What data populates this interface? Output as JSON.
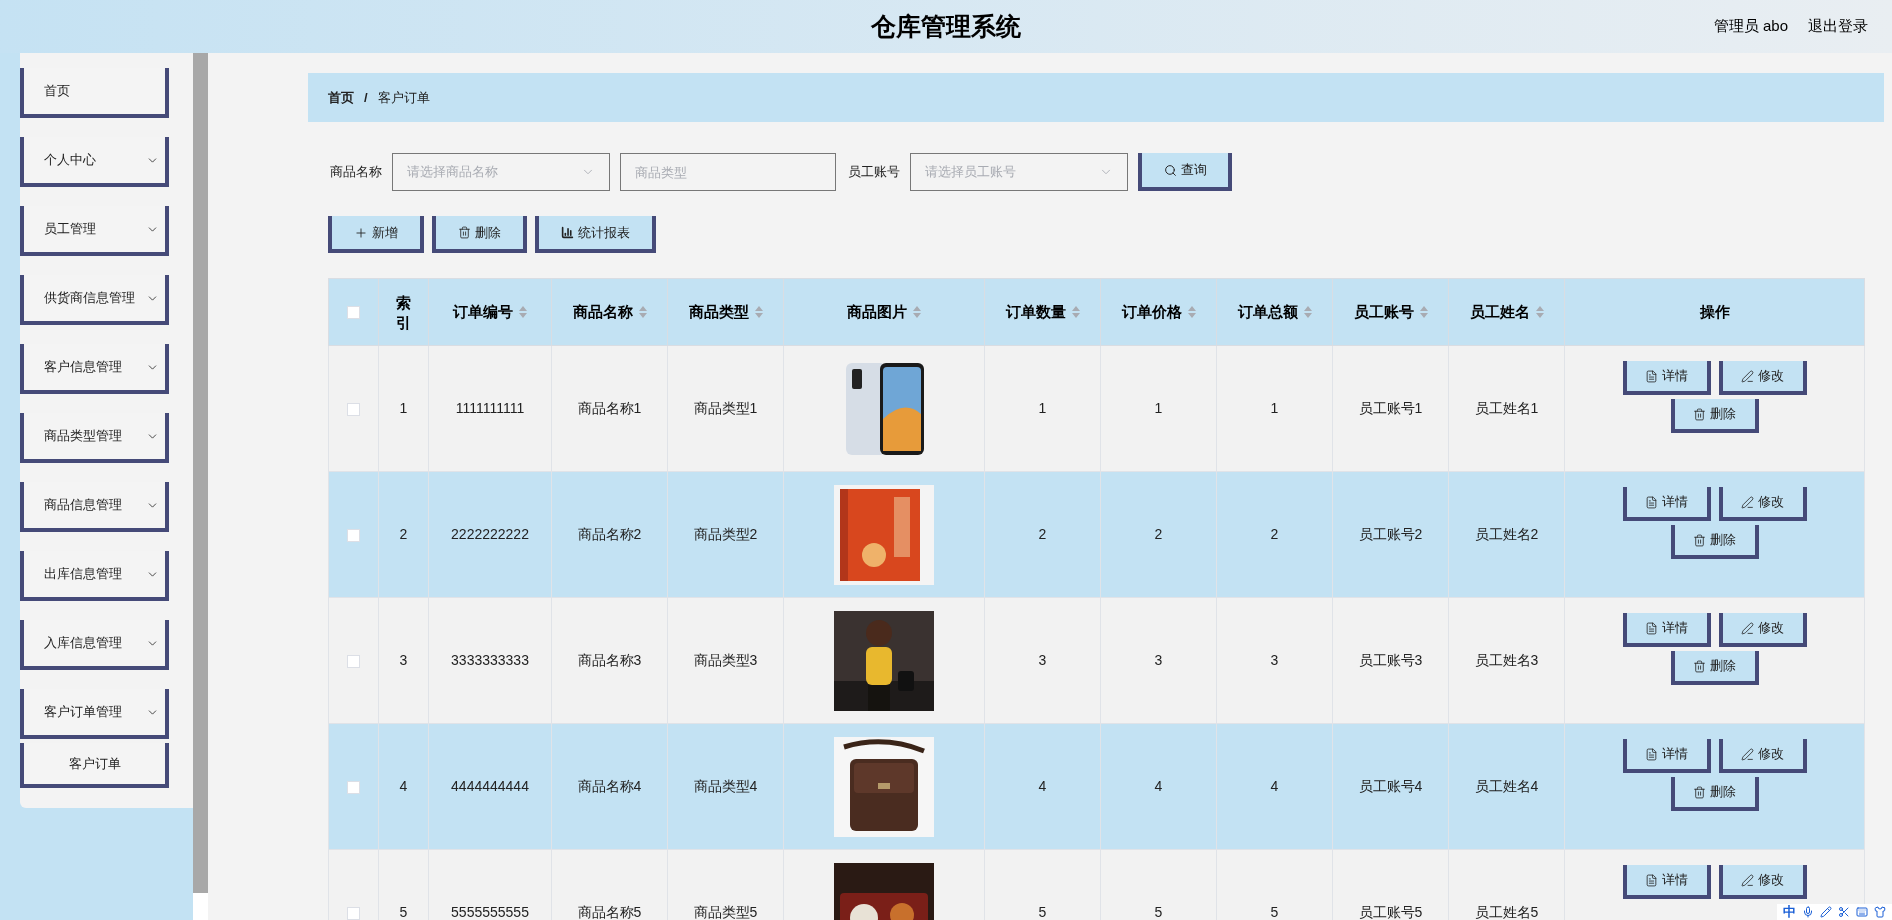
{
  "header": {
    "title": "仓库管理系统",
    "user": "管理员 abo",
    "logout": "退出登录"
  },
  "sidebar": {
    "items": [
      {
        "label": "首页",
        "kind": "link"
      },
      {
        "label": "个人中心",
        "kind": "menu"
      },
      {
        "label": "员工管理",
        "kind": "menu"
      },
      {
        "label": "供货商信息管理",
        "kind": "menu"
      },
      {
        "label": "客户信息管理",
        "kind": "menu"
      },
      {
        "label": "商品类型管理",
        "kind": "menu"
      },
      {
        "label": "商品信息管理",
        "kind": "menu"
      },
      {
        "label": "出库信息管理",
        "kind": "menu"
      },
      {
        "label": "入库信息管理",
        "kind": "menu"
      },
      {
        "label": "客户订单管理",
        "kind": "menu",
        "children": [
          {
            "label": "客户订单"
          }
        ]
      }
    ]
  },
  "breadcrumb": {
    "items": [
      "首页",
      "客户订单"
    ],
    "separator": "/"
  },
  "filters": [
    {
      "kind": "select",
      "label": "商品名称",
      "placeholder": "请选择商品名称"
    },
    {
      "kind": "input",
      "placeholder": "商品类型"
    },
    {
      "kind": "select",
      "label": "员工账号",
      "placeholder": "请选择员工账号"
    }
  ],
  "query_button": "查询",
  "toolbar": [
    {
      "label": "新增",
      "kind": "plus"
    },
    {
      "label": "删除",
      "kind": "trash"
    },
    {
      "label": "统计报表",
      "kind": "chart"
    }
  ],
  "table": {
    "select_all_checked": false,
    "columns": [
      {
        "label": "索引",
        "sortable": false
      },
      {
        "label": "订单编号",
        "sortable": true
      },
      {
        "label": "商品名称",
        "sortable": true
      },
      {
        "label": "商品类型",
        "sortable": true
      },
      {
        "label": "商品图片",
        "sortable": true
      },
      {
        "label": "订单数量",
        "sortable": true
      },
      {
        "label": "订单价格",
        "sortable": true
      },
      {
        "label": "订单总额",
        "sortable": true
      },
      {
        "label": "员工账号",
        "sortable": true
      },
      {
        "label": "员工姓名",
        "sortable": true
      },
      {
        "label": "操作",
        "sortable": false
      }
    ],
    "rows": [
      {
        "checked": false,
        "index": "1",
        "order_no": "1111111111",
        "name": "商品名称1",
        "type": "商品类型1",
        "qty": "1",
        "price": "1",
        "total": "1",
        "account": "员工账号1",
        "staff": "员工姓名1",
        "actions": [
          {
            "label": "详情",
            "kind": "detail"
          },
          {
            "label": "修改",
            "kind": "edit"
          },
          {
            "label": "删除",
            "kind": "trash"
          }
        ]
      },
      {
        "checked": false,
        "index": "2",
        "order_no": "2222222222",
        "name": "商品名称2",
        "type": "商品类型2",
        "qty": "2",
        "price": "2",
        "total": "2",
        "account": "员工账号2",
        "staff": "员工姓名2",
        "actions": [
          {
            "label": "详情",
            "kind": "detail"
          },
          {
            "label": "修改",
            "kind": "edit"
          },
          {
            "label": "删除",
            "kind": "trash"
          }
        ]
      },
      {
        "checked": false,
        "index": "3",
        "order_no": "3333333333",
        "name": "商品名称3",
        "type": "商品类型3",
        "qty": "3",
        "price": "3",
        "total": "3",
        "account": "员工账号3",
        "staff": "员工姓名3",
        "actions": [
          {
            "label": "详情",
            "kind": "detail"
          },
          {
            "label": "修改",
            "kind": "edit"
          },
          {
            "label": "删除",
            "kind": "trash"
          }
        ]
      },
      {
        "checked": false,
        "index": "4",
        "order_no": "4444444444",
        "name": "商品名称4",
        "type": "商品类型4",
        "qty": "4",
        "price": "4",
        "total": "4",
        "account": "员工账号4",
        "staff": "员工姓名4",
        "actions": [
          {
            "label": "详情",
            "kind": "detail"
          },
          {
            "label": "修改",
            "kind": "edit"
          },
          {
            "label": "删除",
            "kind": "trash"
          }
        ]
      },
      {
        "checked": false,
        "index": "5",
        "order_no": "5555555555",
        "name": "商品名称5",
        "type": "商品类型5",
        "qty": "5",
        "price": "5",
        "total": "5",
        "account": "员工账号5",
        "staff": "员工姓名5",
        "actions": [
          {
            "label": "详情",
            "kind": "detail"
          },
          {
            "label": "修改",
            "kind": "edit"
          }
        ]
      }
    ]
  },
  "ime": {
    "mode": "中"
  }
}
